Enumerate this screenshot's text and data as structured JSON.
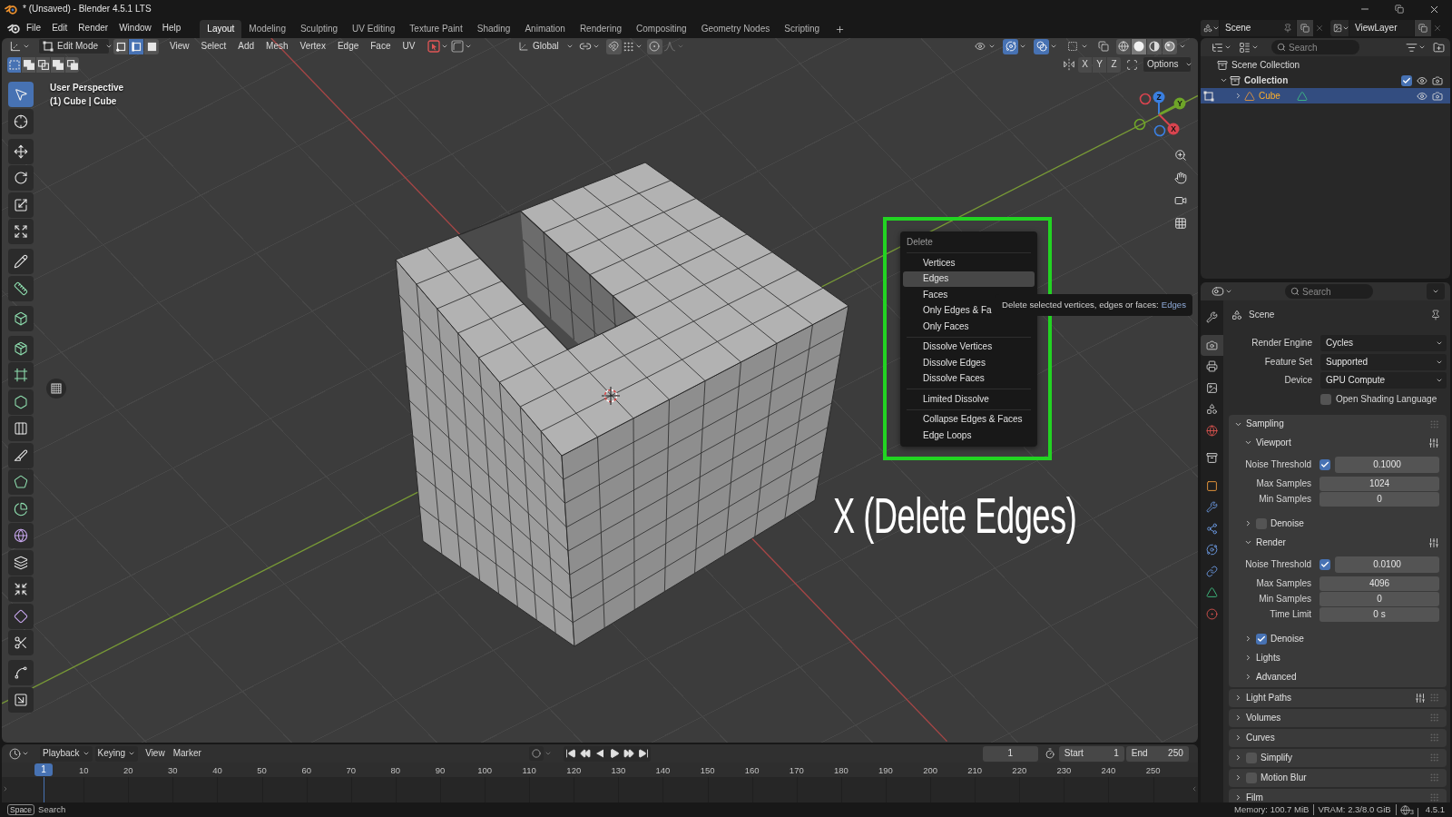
{
  "title_bar": {
    "title": "* (Unsaved) - Blender 4.5.1 LTS"
  },
  "top_bar": {
    "menus": [
      "File",
      "Edit",
      "Render",
      "Window",
      "Help"
    ],
    "workspaces": [
      {
        "label": "Layout",
        "selected": true
      },
      {
        "label": "Modeling",
        "selected": false
      },
      {
        "label": "Sculpting",
        "selected": false
      },
      {
        "label": "UV Editing",
        "selected": false
      },
      {
        "label": "Texture Paint",
        "selected": false
      },
      {
        "label": "Shading",
        "selected": false
      },
      {
        "label": "Animation",
        "selected": false
      },
      {
        "label": "Rendering",
        "selected": false
      },
      {
        "label": "Compositing",
        "selected": false
      },
      {
        "label": "Geometry Nodes",
        "selected": false
      },
      {
        "label": "Scripting",
        "selected": false
      }
    ],
    "scene": "Scene",
    "view_layer": "ViewLayer"
  },
  "viewport": {
    "mode": "Edit Mode",
    "select_modes": [
      {
        "kind": "vertex",
        "selected": false
      },
      {
        "kind": "edge",
        "selected": true
      },
      {
        "kind": "face",
        "selected": false
      }
    ],
    "menus": [
      "View",
      "Select",
      "Add",
      "Mesh",
      "Vertex",
      "Edge",
      "Face",
      "UV"
    ],
    "orientation": "Global",
    "toggles": [
      {
        "kind": "visibility",
        "on": false
      },
      {
        "kind": "gizmo",
        "on": true
      },
      {
        "kind": "overlay",
        "on": true
      },
      {
        "kind": "mesh",
        "on": false
      },
      {
        "kind": "xray",
        "on": false
      }
    ],
    "shading": [
      {
        "kind": "wireframe",
        "selected": false
      },
      {
        "kind": "solid",
        "selected": true
      },
      {
        "kind": "material",
        "selected": false
      },
      {
        "kind": "rendered",
        "selected": false
      }
    ],
    "selection_ops": [
      {
        "kind": "new",
        "selected": true
      },
      {
        "kind": "extend",
        "selected": false
      },
      {
        "kind": "subtract",
        "selected": false
      },
      {
        "kind": "invert",
        "selected": false
      },
      {
        "kind": "intersect",
        "selected": false
      }
    ],
    "mirror_axes": [
      "X",
      "Y",
      "Z"
    ],
    "options": "Options",
    "info": [
      "User Perspective",
      "(1) Cube | Cube"
    ],
    "tool_groups": [
      [
        {
          "kind": "select",
          "selected": true
        },
        {
          "kind": "cursor",
          "selected": false
        }
      ],
      [
        {
          "kind": "move",
          "selected": false
        },
        {
          "kind": "rotate",
          "selected": false
        },
        {
          "kind": "scale",
          "selected": false
        },
        {
          "kind": "transform",
          "selected": false
        }
      ],
      [
        {
          "kind": "annotate",
          "selected": false
        },
        {
          "kind": "measure",
          "selected": false
        }
      ],
      [
        {
          "kind": "add-cube",
          "selected": false
        }
      ],
      [
        {
          "kind": "extrude",
          "selected": false
        },
        {
          "kind": "inset",
          "selected": false
        },
        {
          "kind": "bevel",
          "selected": false
        },
        {
          "kind": "loop-cut",
          "selected": false
        },
        {
          "kind": "knife",
          "selected": false
        },
        {
          "kind": "poly-build",
          "selected": false
        },
        {
          "kind": "spin",
          "selected": false
        },
        {
          "kind": "smooth",
          "selected": false
        },
        {
          "kind": "edge-slide",
          "selected": false
        },
        {
          "kind": "shrink",
          "selected": false
        },
        {
          "kind": "shear",
          "selected": false
        },
        {
          "kind": "rip",
          "selected": false
        }
      ],
      [
        {
          "kind": "curve",
          "selected": false
        },
        {
          "kind": "arrow-box",
          "selected": false
        }
      ]
    ],
    "gizmo_axes": [
      "Z",
      "Y",
      "X"
    ],
    "delete_menu": {
      "title": "Delete",
      "sections": [
        [
          {
            "label": "Vertices",
            "selected": false
          },
          {
            "label": "Edges",
            "selected": true
          },
          {
            "label": "Faces",
            "selected": false
          },
          {
            "label": "Only Edges & Fa",
            "selected": false
          },
          {
            "label": "Only Faces",
            "selected": false
          }
        ],
        [
          {
            "label": "Dissolve Vertices",
            "selected": false
          },
          {
            "label": "Dissolve Edges",
            "selected": false
          },
          {
            "label": "Dissolve Faces",
            "selected": false
          }
        ],
        [
          {
            "label": "Limited Dissolve",
            "selected": false
          }
        ],
        [
          {
            "label": "Collapse Edges & Faces",
            "selected": false
          },
          {
            "label": "Edge Loops",
            "selected": false
          }
        ]
      ]
    },
    "tooltip": {
      "text": "Delete selected vertices, edges or faces:",
      "value": "Edges"
    },
    "annotation": "X (Delete Edges)"
  },
  "outliner": {
    "search": {
      "placeholder": "Search"
    },
    "tree": [
      {
        "label": "Scene Collection",
        "kind": "scene-collection",
        "selected": false,
        "children": [
          {
            "label": "Collection",
            "kind": "collection",
            "selected": false,
            "expanded": true,
            "checked": true,
            "children": [
              {
                "label": "Cube",
                "kind": "object",
                "selected": true,
                "expanded": false
              }
            ]
          }
        ]
      }
    ]
  },
  "properties": {
    "search": {
      "placeholder": "Search"
    },
    "tab_groups": [
      [
        {
          "kind": "tool",
          "selected": false
        }
      ],
      [
        {
          "kind": "render",
          "selected": true
        },
        {
          "kind": "output",
          "selected": false
        },
        {
          "kind": "view-layer",
          "selected": false
        },
        {
          "kind": "scene",
          "selected": false
        },
        {
          "kind": "world",
          "selected": false
        }
      ],
      [
        {
          "kind": "collection",
          "selected": false
        }
      ],
      [
        {
          "kind": "object",
          "selected": false
        },
        {
          "kind": "modifiers",
          "selected": false
        },
        {
          "kind": "particles",
          "selected": false
        },
        {
          "kind": "physics",
          "selected": false
        },
        {
          "kind": "constraints",
          "selected": false
        },
        {
          "kind": "data",
          "selected": false
        },
        {
          "kind": "material",
          "selected": false
        }
      ]
    ],
    "context": "Scene",
    "fields": [
      {
        "kind": "dropdown",
        "label": "Render Engine",
        "value": "Cycles"
      },
      {
        "kind": "dropdown",
        "label": "Feature Set",
        "value": "Supported"
      },
      {
        "kind": "dropdown",
        "label": "Device",
        "value": "GPU Compute"
      },
      {
        "kind": "checkbox",
        "label": "Open Shading Language",
        "checked": false
      }
    ],
    "panels": [
      {
        "kind": "panel",
        "title": "Sampling",
        "expanded": true,
        "presets": false,
        "sections": [
          {
            "kind": "subpanel",
            "title": "Viewport",
            "expanded": true,
            "presets": true,
            "rows": [
              {
                "kind": "toggle-number",
                "label": "Noise Threshold",
                "checked": true,
                "value": "0.1000"
              },
              {
                "kind": "number",
                "label": "Max Samples",
                "value": "1024"
              },
              {
                "kind": "number",
                "label": "Min Samples",
                "value": "0"
              }
            ]
          },
          {
            "kind": "toggle-subpanel",
            "title": "Denoise",
            "expanded": false,
            "checked": false,
            "presets": false
          },
          {
            "kind": "subpanel",
            "title": "Render",
            "expanded": true,
            "presets": true,
            "rows": [
              {
                "kind": "toggle-number",
                "label": "Noise Threshold",
                "checked": true,
                "value": "0.0100"
              },
              {
                "kind": "number",
                "label": "Max Samples",
                "value": "4096"
              },
              {
                "kind": "number",
                "label": "Min Samples",
                "value": "0"
              },
              {
                "kind": "number",
                "label": "Time Limit",
                "value": "0 s"
              }
            ]
          },
          {
            "kind": "toggle-subpanel",
            "title": "Denoise",
            "expanded": false,
            "checked": true,
            "presets": false
          },
          {
            "kind": "subpanel",
            "title": "Lights",
            "expanded": false,
            "presets": false
          },
          {
            "kind": "subpanel",
            "title": "Advanced",
            "expanded": false,
            "presets": false
          }
        ]
      },
      {
        "kind": "panel",
        "title": "Light Paths",
        "expanded": false,
        "presets": true
      },
      {
        "kind": "panel",
        "title": "Volumes",
        "expanded": false,
        "presets": false
      },
      {
        "kind": "panel",
        "title": "Curves",
        "expanded": false,
        "presets": false
      },
      {
        "kind": "toggle-panel",
        "title": "Simplify",
        "expanded": false,
        "checked": false,
        "presets": false
      },
      {
        "kind": "toggle-panel",
        "title": "Motion Blur",
        "expanded": false,
        "checked": false,
        "presets": false
      },
      {
        "kind": "panel",
        "title": "Film",
        "expanded": false,
        "presets": false
      }
    ]
  },
  "timeline": {
    "menus": [
      {
        "label": "Playback",
        "dropdown": true
      },
      {
        "label": "Keying",
        "dropdown": true
      },
      {
        "label": "View",
        "dropdown": false
      },
      {
        "label": "Marker",
        "dropdown": false
      }
    ],
    "current_frame": "1",
    "start": {
      "label": "Start",
      "value": "1"
    },
    "end": {
      "label": "End",
      "value": "250"
    },
    "ruler": {
      "current": "1",
      "labels": [
        "10",
        "20",
        "30",
        "40",
        "50",
        "60",
        "70",
        "80",
        "90",
        "100",
        "110",
        "120",
        "130",
        "140",
        "150",
        "160",
        "170",
        "180",
        "190",
        "200",
        "210",
        "220",
        "230",
        "240",
        "250"
      ]
    }
  },
  "status_bar": {
    "key": "Space",
    "action": "Search",
    "stats": [
      "Memory: 100.7 MiB",
      "VRAM: 2.3/8.0 GiB"
    ],
    "network_count": "3",
    "version": "4.5.1"
  }
}
